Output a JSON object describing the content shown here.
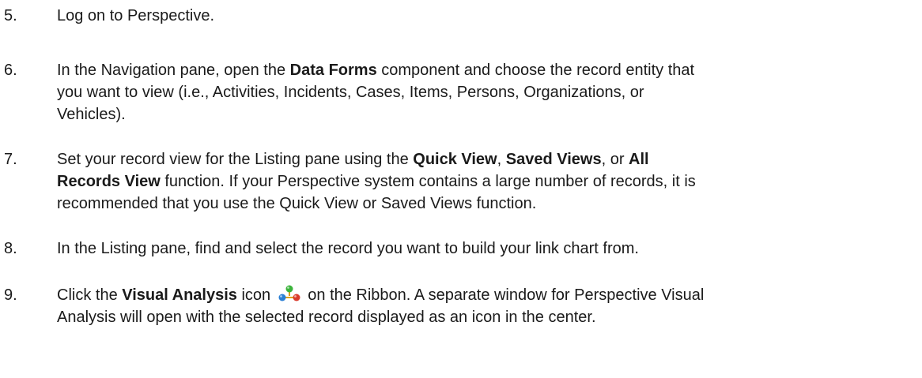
{
  "steps": [
    {
      "number": "5.",
      "segments": [
        {
          "t": "Log on to Perspective."
        }
      ]
    },
    {
      "number": "6.",
      "segments": [
        {
          "t": "In the Navigation pane, open the "
        },
        {
          "t": "Data Forms",
          "b": true
        },
        {
          "t": " component and choose the record entity that"
        },
        {
          "br": true
        },
        {
          "t": "you want to view (i.e., Activities, Incidents, Cases, Items, Persons, Organizations, or"
        },
        {
          "br": true
        },
        {
          "t": "Vehicles)."
        }
      ]
    },
    {
      "number": "7.",
      "segments": [
        {
          "t": "Set your record view for the Listing pane using the "
        },
        {
          "t": "Quick View",
          "b": true
        },
        {
          "t": ", "
        },
        {
          "t": "Saved Views",
          "b": true
        },
        {
          "t": ", or "
        },
        {
          "t": "All",
          "b": true
        },
        {
          "br": true
        },
        {
          "t": "Records View",
          "b": true
        },
        {
          "t": " function. If your Perspective system contains a large number of records, it is"
        },
        {
          "br": true
        },
        {
          "t": "recommended that you use the Quick View or Saved Views function."
        }
      ]
    },
    {
      "number": "8.",
      "segments": [
        {
          "t": "In the Listing pane, find and select the record you want to build your link chart from."
        }
      ]
    },
    {
      "number": "9.",
      "segments": [
        {
          "t": "Click the "
        },
        {
          "t": "Visual Analysis",
          "b": true
        },
        {
          "t": " icon "
        },
        {
          "icon": "visual-analysis-icon"
        },
        {
          "t": " on the Ribbon. A separate window for Perspective Visual"
        },
        {
          "br": true
        },
        {
          "t": "Analysis will open with the selected record displayed as an icon in the center."
        }
      ]
    }
  ]
}
